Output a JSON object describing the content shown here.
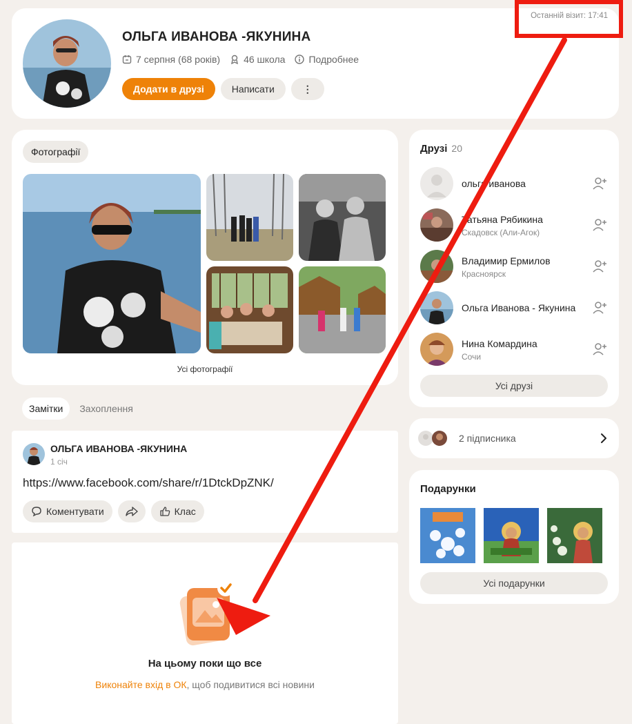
{
  "profile": {
    "name": "ОЛЬГА ИВАНОВА -ЯКУНИНА",
    "birthday": "7 серпня (68 років)",
    "school": "46 школа",
    "more": "Подробнее",
    "add_friend": "Додати в друзі",
    "write": "Написати",
    "more_menu": "⋮",
    "last_visit": "Останній візит: 17:41"
  },
  "photos": {
    "section_label": "Фотографії",
    "all_link": "Усі фотографії"
  },
  "tabs": [
    {
      "label": "Замітки"
    },
    {
      "label": "Захоплення"
    }
  ],
  "post": {
    "author": "ОЛЬГА ИВАНОВА -ЯКУНИНА",
    "date": "1 січ",
    "text": "https://www.facebook.com/share/r/1DtckDpZNK/",
    "comment": "Коментувати",
    "klass": "Клас"
  },
  "empty": {
    "title": "На цьому поки що все",
    "link": "Виконайте вхід в ОК",
    "rest": ", щоб подивитися всі новини"
  },
  "friends": {
    "title": "Друзі",
    "count": "20",
    "items": [
      {
        "name": "ольга иванова",
        "city": ""
      },
      {
        "name": "Татьяна Рябикина",
        "city": "Скадовск (Али-Агок)"
      },
      {
        "name": "Владимир Ермилов",
        "city": "Красноярск"
      },
      {
        "name": "Ольга Иванова - Якунина",
        "city": ""
      },
      {
        "name": "Нина Комардина",
        "city": "Сочи"
      }
    ],
    "all": "Усі друзі"
  },
  "subscribers": {
    "label": "2 підписника"
  },
  "gifts": {
    "title": "Подарунки",
    "all": "Усі подарунки"
  },
  "colors": {
    "accent": "#ee8208",
    "background": "#f4f0ec",
    "annotation": "#ee1c10"
  }
}
